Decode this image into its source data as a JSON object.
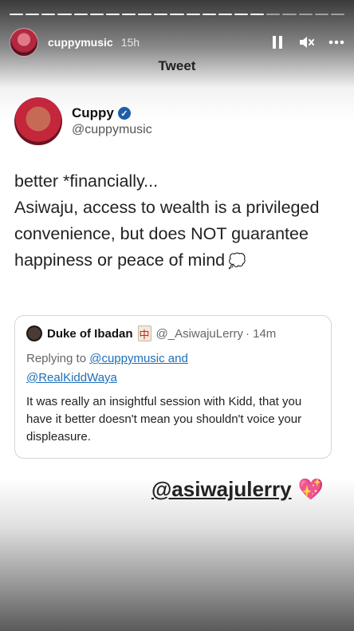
{
  "story": {
    "username": "cuppymusic",
    "time_ago": "15h",
    "segments_total": 21,
    "segments_done": 16,
    "controls": {
      "pause_icon": "pause-icon",
      "mute_icon": "mute-icon",
      "more_icon": "more-icon"
    }
  },
  "tweet": {
    "header_title": "Tweet",
    "display_name": "Cuppy",
    "handle": "@cuppymusic",
    "verified_icon": "verified-badge-icon",
    "body_lines": [
      "better *financially...",
      "Asiwaju, access to wealth is a privileged convenience, but does NOT guarantee happiness or peace of mind"
    ],
    "thought_emoji": "💭"
  },
  "quote": {
    "display_name": "Duke of Ibadan",
    "emoji": "🀄",
    "handle": "@_AsiwajuLerry",
    "time": "· 14m",
    "replying_prefix": "Replying to ",
    "reply_user_1": "@cuppymusic and",
    "reply_user_2": "@RealKiddWaya",
    "text": "It was really an insightful session with Kidd, that you have it better doesn't mean you shouldn't voice your displeasure."
  },
  "sticker": {
    "mention": "@asiwajulerry",
    "emoji": "💖"
  },
  "colors": {
    "verified": "#1d5ea8",
    "link": "#1d6fb8",
    "heart": "#e35ad1"
  }
}
